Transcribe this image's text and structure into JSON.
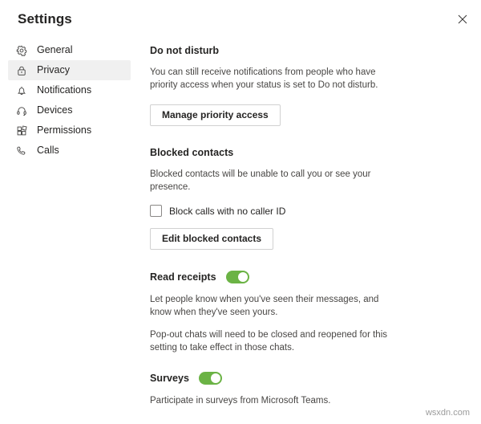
{
  "window": {
    "title": "Settings",
    "close_label": "✕",
    "close_icon": "close-icon"
  },
  "sidebar": {
    "items": [
      {
        "label": "General",
        "icon": "gear-icon",
        "selected": false
      },
      {
        "label": "Privacy",
        "icon": "lock-icon",
        "selected": true
      },
      {
        "label": "Notifications",
        "icon": "bell-icon",
        "selected": false
      },
      {
        "label": "Devices",
        "icon": "headset-icon",
        "selected": false
      },
      {
        "label": "Permissions",
        "icon": "app-grid-icon",
        "selected": false
      },
      {
        "label": "Calls",
        "icon": "phone-icon",
        "selected": false
      }
    ]
  },
  "main": {
    "do_not_disturb": {
      "heading": "Do not disturb",
      "description": "You can still receive notifications from people who have priority access when your status is set to Do not disturb.",
      "button_label": "Manage priority access"
    },
    "blocked_contacts": {
      "heading": "Blocked contacts",
      "description": "Blocked contacts will be unable to call you or see your presence.",
      "checkbox_label": "Block calls with no caller ID",
      "checkbox_checked": "false",
      "button_label": "Edit blocked contacts"
    },
    "read_receipts": {
      "heading": "Read receipts",
      "toggle_state": "on",
      "description_1": "Let people know when you've seen their messages, and know when they've seen yours.",
      "description_2": "Pop-out chats will need to be closed and reopened for this setting to take effect in those chats."
    },
    "surveys": {
      "heading": "Surveys",
      "toggle_state": "on",
      "description": "Participate in surveys from Microsoft Teams."
    }
  },
  "colors": {
    "toggle_on": "#6bb345",
    "selected_nav_bg": "#f0f0f0",
    "text_primary": "#252423",
    "text_secondary": "#484644",
    "border": "#d1d1d1"
  },
  "watermark": {
    "text": "wsxdn.com"
  }
}
